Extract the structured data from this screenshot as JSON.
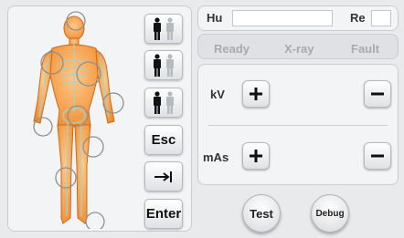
{
  "hu_label": "Hu",
  "re_label": "Re",
  "status": {
    "ready": "Ready",
    "xray": "X-ray",
    "fault": "Fault"
  },
  "kv_label": "kV",
  "mas_label": "mAs",
  "side_buttons": {
    "esc": "Esc",
    "enter": "Enter"
  },
  "test_label": "Test",
  "debug_label": "Debug"
}
